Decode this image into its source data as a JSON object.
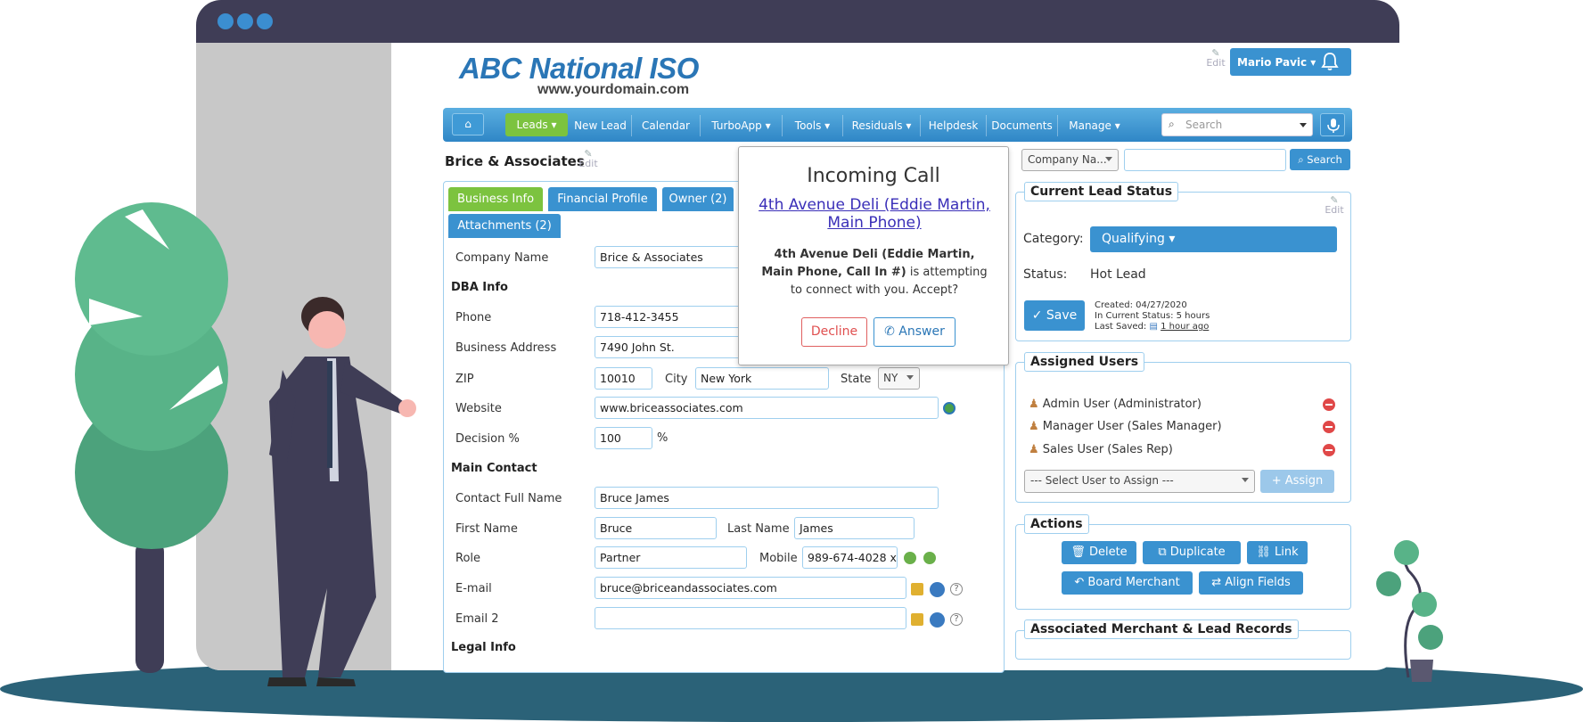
{
  "brand": {
    "name": "ABC National ISO",
    "domain": "www.yourdomain.com"
  },
  "edit_label": "Edit",
  "user": {
    "name": "Mario Pavic"
  },
  "nav": {
    "home_icon": "home-icon",
    "items": [
      "Leads",
      "New Lead",
      "Calendar",
      "TurboApp",
      "Tools",
      "Residuals",
      "Helpdesk",
      "Documents",
      "Manage"
    ],
    "search_placeholder": "Search"
  },
  "page": {
    "title": "Brice & Associates"
  },
  "tabs": [
    "Business Info",
    "Financial Profile",
    "Owner (2)",
    "Attachments (2)"
  ],
  "form": {
    "company_name_label": "Company Name",
    "company_name": "Brice & Associates",
    "dba_section": "DBA Info",
    "phone_label": "Phone",
    "phone": "718-412-3455",
    "address_label": "Business Address",
    "address": "7490 John St.",
    "zip_label": "ZIP",
    "zip": "10010",
    "city_label": "City",
    "city": "New York",
    "state_label": "State",
    "state": "NY",
    "website_label": "Website",
    "website": "www.briceassociates.com",
    "decision_label": "Decision %",
    "decision": "100",
    "decision_unit": "%",
    "contact_section": "Main Contact",
    "contact_full_label": "Contact Full Name",
    "contact_full": "Bruce James",
    "first_label": "First Name",
    "first": "Bruce",
    "last_label": "Last Name",
    "last": "James",
    "role_label": "Role",
    "role": "Partner",
    "mobile_label": "Mobile",
    "mobile": "989-674-4028 x",
    "email_label": "E-mail",
    "email": "bruce@briceandassociates.com",
    "email2_label": "Email 2",
    "email2": "",
    "legal_section": "Legal Info"
  },
  "modal": {
    "title": "Incoming Call",
    "link": "4th Avenue Deli (Eddie Martin, Main Phone)",
    "body_bold": "4th Avenue Deli (Eddie Martin, Main Phone, Call In #)",
    "body_rest": " is attempting to connect with you. Accept?",
    "decline": "Decline",
    "answer": "Answer"
  },
  "right_search": {
    "select": "Company Na...",
    "value": "",
    "button": "Search"
  },
  "lead_status": {
    "legend": "Current Lead Status",
    "category_label": "Category:",
    "category": "Qualifying",
    "status_label": "Status:",
    "status": "Hot Lead",
    "save": "Save",
    "created": "Created: 04/27/2020",
    "in_status": "In Current Status: 5 hours",
    "last_saved_label": "Last Saved:",
    "last_saved": "1 hour ago"
  },
  "assigned_users": {
    "legend": "Assigned Users",
    "users": [
      "Admin User (Administrator)",
      "Manager User (Sales Manager)",
      "Sales User (Sales Rep)"
    ],
    "select": "--- Select User to Assign ---",
    "assign": "+ Assign"
  },
  "actions": {
    "legend": "Actions",
    "delete": "Delete",
    "duplicate": "Duplicate",
    "link": "Link",
    "board": "Board Merchant",
    "align": "Align Fields"
  },
  "associated": {
    "legend": "Associated Merchant & Lead Records"
  },
  "colors": {
    "primary": "#3a92d0",
    "green": "#7cc33f",
    "frame": "#3f3d56",
    "ground": "#2b6278",
    "danger": "#e04848"
  }
}
